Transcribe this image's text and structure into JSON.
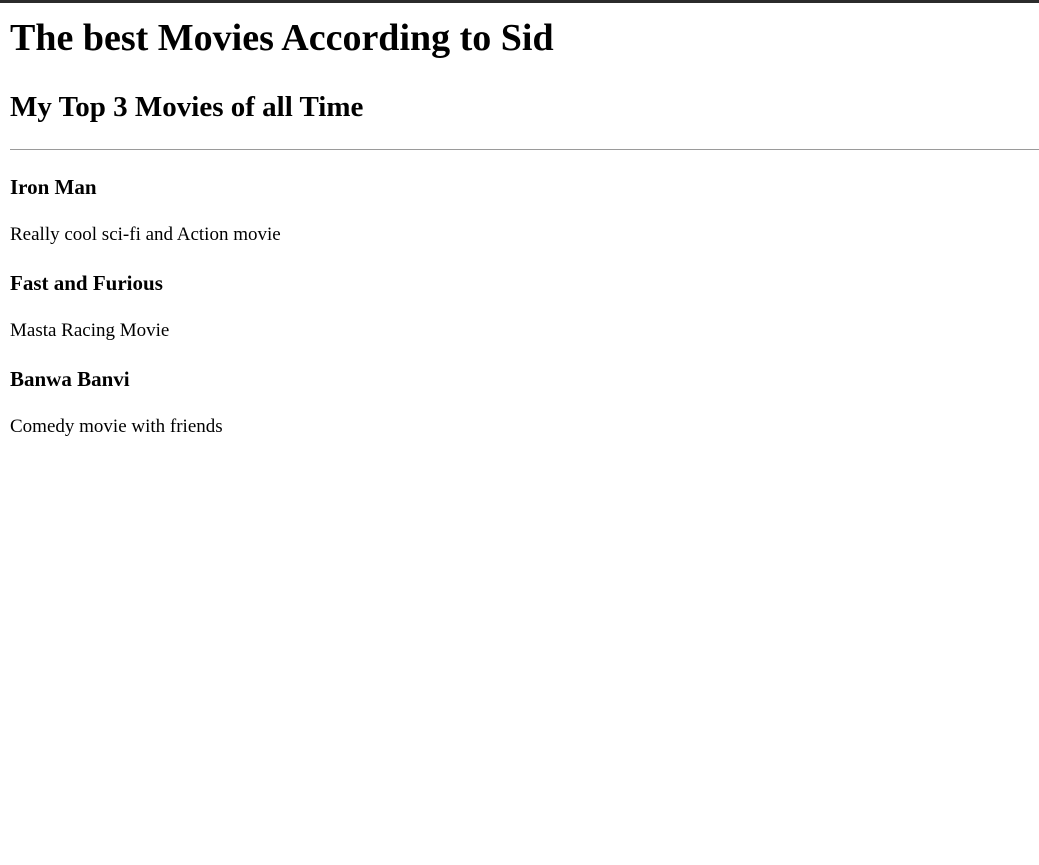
{
  "page": {
    "title": "The best Movies According to Sid",
    "subtitle": "My Top 3 Movies of all Time"
  },
  "movies": [
    {
      "name": "Iron Man",
      "description": "Really cool sci-fi and Action movie"
    },
    {
      "name": "Fast and Furious",
      "description": "Masta Racing Movie"
    },
    {
      "name": "Banwa Banvi",
      "description": "Comedy movie with friends"
    }
  ],
  "colors": {
    "text": "#000000",
    "background": "#ffffff",
    "top_border": "#2b2b2b",
    "divider": "#9a9a9a"
  }
}
